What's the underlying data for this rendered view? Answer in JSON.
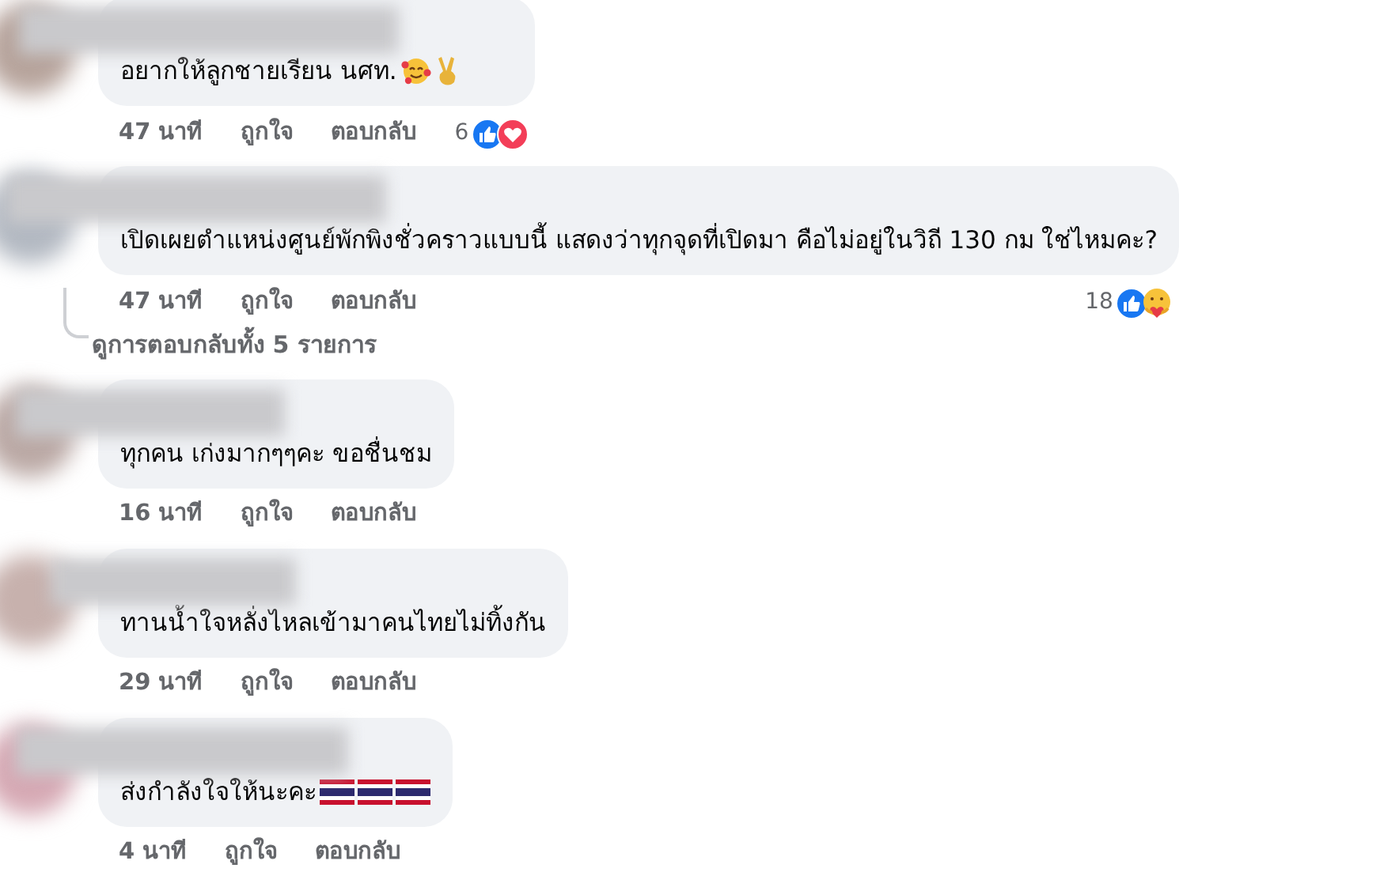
{
  "comments": [
    {
      "text": "อยากให้ลูกชายเรียน นศท.",
      "emojis": [
        {
          "kind": "smiling-hearts"
        },
        {
          "kind": "victory"
        }
      ],
      "time": "47 นาที",
      "like": "ถูกใจ",
      "reply": "ตอบกลับ",
      "reactions": {
        "count": "6",
        "types": [
          {
            "kind": "like"
          },
          {
            "kind": "love"
          }
        ]
      }
    },
    {
      "text": "เปิดเผยตำแหน่งศูนย์พักพิงชั่วคราวแบบนี้ แสดงว่าทุกจุดที่เปิดมา คือไม่อยู่ในวิถี 130 กม ใช่ไหมคะ?",
      "time": "47 นาที",
      "like": "ถูกใจ",
      "reply": "ตอบกลับ",
      "reactions": {
        "count": "18",
        "types": [
          {
            "kind": "like"
          },
          {
            "kind": "care"
          }
        ]
      },
      "view_replies": "ดูการตอบกลับทั้ง 5 รายการ"
    },
    {
      "text": "ทุกคน เก่งมากๆๆคะ ขอชื่นชม",
      "time": "16 นาที",
      "like": "ถูกใจ",
      "reply": "ตอบกลับ"
    },
    {
      "text": "ทานน้ำใจหลั่งไหลเข้ามาคนไทยไม่ทิ้งกัน",
      "time": "29 นาที",
      "like": "ถูกใจ",
      "reply": "ตอบกลับ"
    },
    {
      "text": "ส่งกำลังใจให้นะคะ",
      "emojis": [
        {
          "kind": "thai-flag"
        },
        {
          "kind": "thai-flag"
        },
        {
          "kind": "thai-flag"
        }
      ],
      "time": "4 นาที",
      "like": "ถูกใจ",
      "reply": "ตอบกลับ"
    }
  ]
}
